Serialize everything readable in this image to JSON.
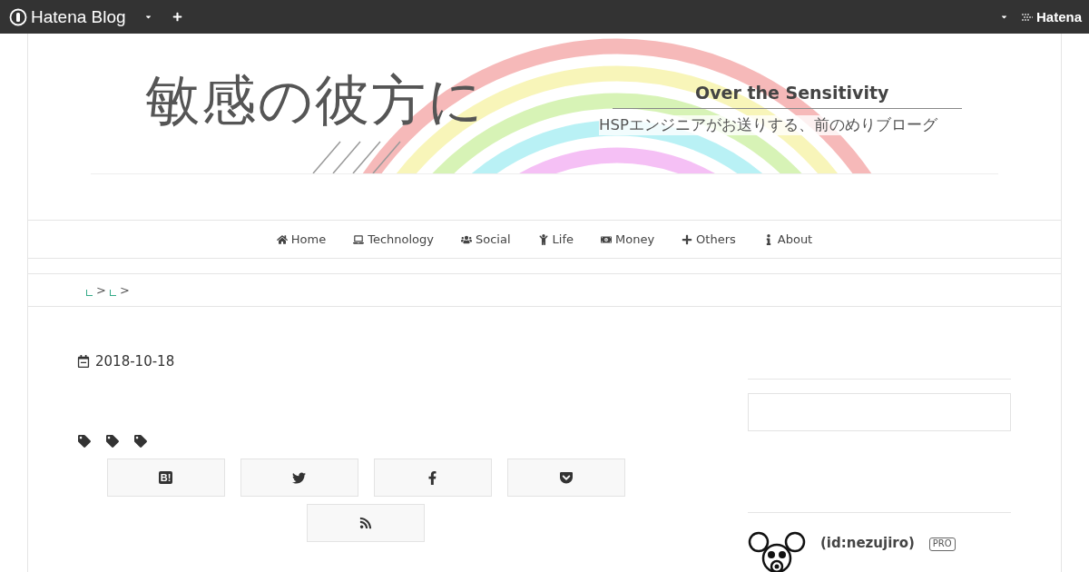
{
  "topbar": {
    "brand": "Hatena Blog",
    "right_brand": "Hatena"
  },
  "banner": {
    "title": "敏感の彼方に",
    "subtitle": "Over the Sensitivity",
    "tagline": "HSPエンジニアがお送りする、前のめりブローグ"
  },
  "nav": [
    {
      "kind": "home",
      "label": "Home"
    },
    {
      "kind": "laptop",
      "label": "Technology"
    },
    {
      "kind": "users",
      "label": "Social"
    },
    {
      "kind": "child",
      "label": "Life"
    },
    {
      "kind": "money",
      "label": "Money"
    },
    {
      "kind": "plus",
      "label": "Others"
    },
    {
      "kind": "info",
      "label": "About"
    }
  ],
  "breadcrumb": [
    ">",
    ">"
  ],
  "entry": {
    "date": "2018-10-18",
    "tags": [
      {
        "kind": "tag"
      },
      {
        "kind": "tag"
      },
      {
        "kind": "tag"
      }
    ]
  },
  "share": [
    {
      "kind": "hatena",
      "label": "B!"
    },
    {
      "kind": "twitter"
    },
    {
      "kind": "facebook"
    },
    {
      "kind": "pocket"
    },
    {
      "kind": "rss"
    }
  ],
  "profile": {
    "id": "(id:nezujiro)",
    "badge": "PRO"
  }
}
